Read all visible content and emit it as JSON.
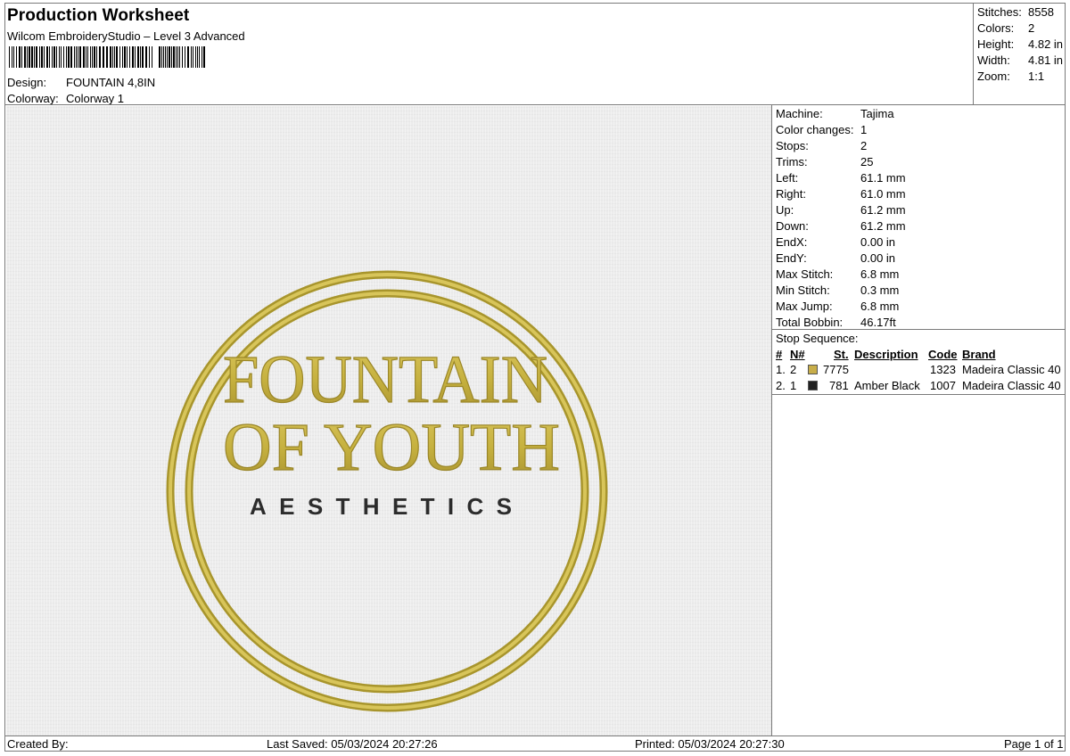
{
  "header": {
    "title": "Production Worksheet",
    "subtitle": "Wilcom EmbroideryStudio – Level 3 Advanced",
    "design_label": "Design:",
    "design_value": "FOUNTAIN 4,8IN",
    "colorway_label": "Colorway:",
    "colorway_value": "Colorway 1"
  },
  "summary": [
    {
      "label": "Stitches:",
      "value": "8558"
    },
    {
      "label": "Colors:",
      "value": "2"
    },
    {
      "label": "Height:",
      "value": "4.82 in"
    },
    {
      "label": "Width:",
      "value": "4.81 in"
    },
    {
      "label": "Zoom:",
      "value": "1:1"
    }
  ],
  "specs": [
    {
      "label": "Machine:",
      "value": "Tajima"
    },
    {
      "label": "Color changes:",
      "value": "1"
    },
    {
      "label": "Stops:",
      "value": "2"
    },
    {
      "label": "Trims:",
      "value": "25"
    },
    {
      "label": "Left:",
      "value": "61.1 mm"
    },
    {
      "label": "Right:",
      "value": "61.0 mm"
    },
    {
      "label": "Up:",
      "value": "61.2 mm"
    },
    {
      "label": "Down:",
      "value": "61.2 mm"
    },
    {
      "label": "EndX:",
      "value": "0.00 in"
    },
    {
      "label": "EndY:",
      "value": "0.00 in"
    },
    {
      "label": "Max Stitch:",
      "value": "6.8 mm"
    },
    {
      "label": "Min Stitch:",
      "value": "0.3 mm"
    },
    {
      "label": "Max Jump:",
      "value": "6.8 mm"
    },
    {
      "label": "Total Bobbin:",
      "value": "46.17ft"
    }
  ],
  "stop_sequence": {
    "label": "Stop Sequence:",
    "columns": {
      "num": "#",
      "n": "N#",
      "st": "St.",
      "desc": "Description",
      "code": "Code",
      "brand": "Brand"
    },
    "rows": [
      {
        "num": "1.",
        "n": "2",
        "color": "#c8ae4a",
        "st": "7775",
        "desc": "",
        "code": "1323",
        "brand": "Madeira Classic 40"
      },
      {
        "num": "2.",
        "n": "1",
        "color": "#222222",
        "st": "781",
        "desc": "Amber Black",
        "code": "1007",
        "brand": "Madeira Classic 40"
      }
    ]
  },
  "design": {
    "line1": "FOUNTAIN",
    "line2": "OF YOUTH",
    "line3": "AESTHETICS",
    "thread_gold": "#c6b13f",
    "thread_dark": "#2c2c2c",
    "fabric": "#ececec"
  },
  "footer": {
    "created_by": "Created By:",
    "last_saved": "Last Saved: 05/03/2024 20:27:26",
    "printed": "Printed: 05/03/2024 20:27:30",
    "page": "Page 1 of 1"
  }
}
